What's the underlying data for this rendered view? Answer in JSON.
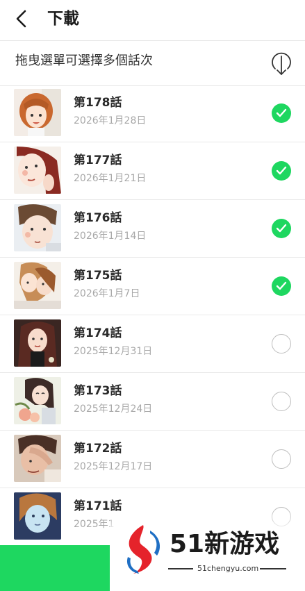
{
  "header": {
    "title": "下載"
  },
  "subbar": {
    "hint": "拖曳選單可選擇多個話次"
  },
  "episodes": [
    {
      "title": "第178話",
      "date": "2026年1月28日",
      "selected": true
    },
    {
      "title": "第177話",
      "date": "2026年1月21日",
      "selected": true
    },
    {
      "title": "第176話",
      "date": "2026年1月14日",
      "selected": true
    },
    {
      "title": "第175話",
      "date": "2026年1月7日",
      "selected": true
    },
    {
      "title": "第174話",
      "date": "2025年12月31日",
      "selected": false
    },
    {
      "title": "第173話",
      "date": "2025年12月24日",
      "selected": false
    },
    {
      "title": "第172話",
      "date": "2025年12月17日",
      "selected": false
    },
    {
      "title": "第171話",
      "date": "2025年1",
      "selected": false
    }
  ],
  "watermark": {
    "brand": "51新游戏",
    "url": "51chengyu.com"
  },
  "colors": {
    "accent": "#1ed760",
    "check_off_border": "#bdbdbd",
    "date_text": "#a8a8a8"
  },
  "icons": {
    "back": "chevron-left-icon",
    "download": "download-arrow-icon",
    "selected": "checkmark-circle-icon",
    "unselected": "empty-circle-icon"
  }
}
